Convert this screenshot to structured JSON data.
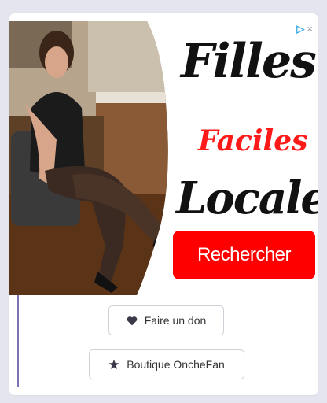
{
  "ad": {
    "choices_icon": "adchoices-icon",
    "close_glyph": "×",
    "line1": "Filles",
    "line2": "Faciles",
    "line3": "Locales",
    "cta_label": "Rechercher",
    "cta_color": "#ff0000",
    "line2_color": "#ff1a1a"
  },
  "actions": {
    "donate_label": "Faire un don",
    "donate_icon": "heart-icon",
    "shop_label": "Boutique OncheFan",
    "shop_icon": "star-icon"
  },
  "colors": {
    "page_bg": "#e4e5ee",
    "accent_rule": "#7b74b8"
  }
}
